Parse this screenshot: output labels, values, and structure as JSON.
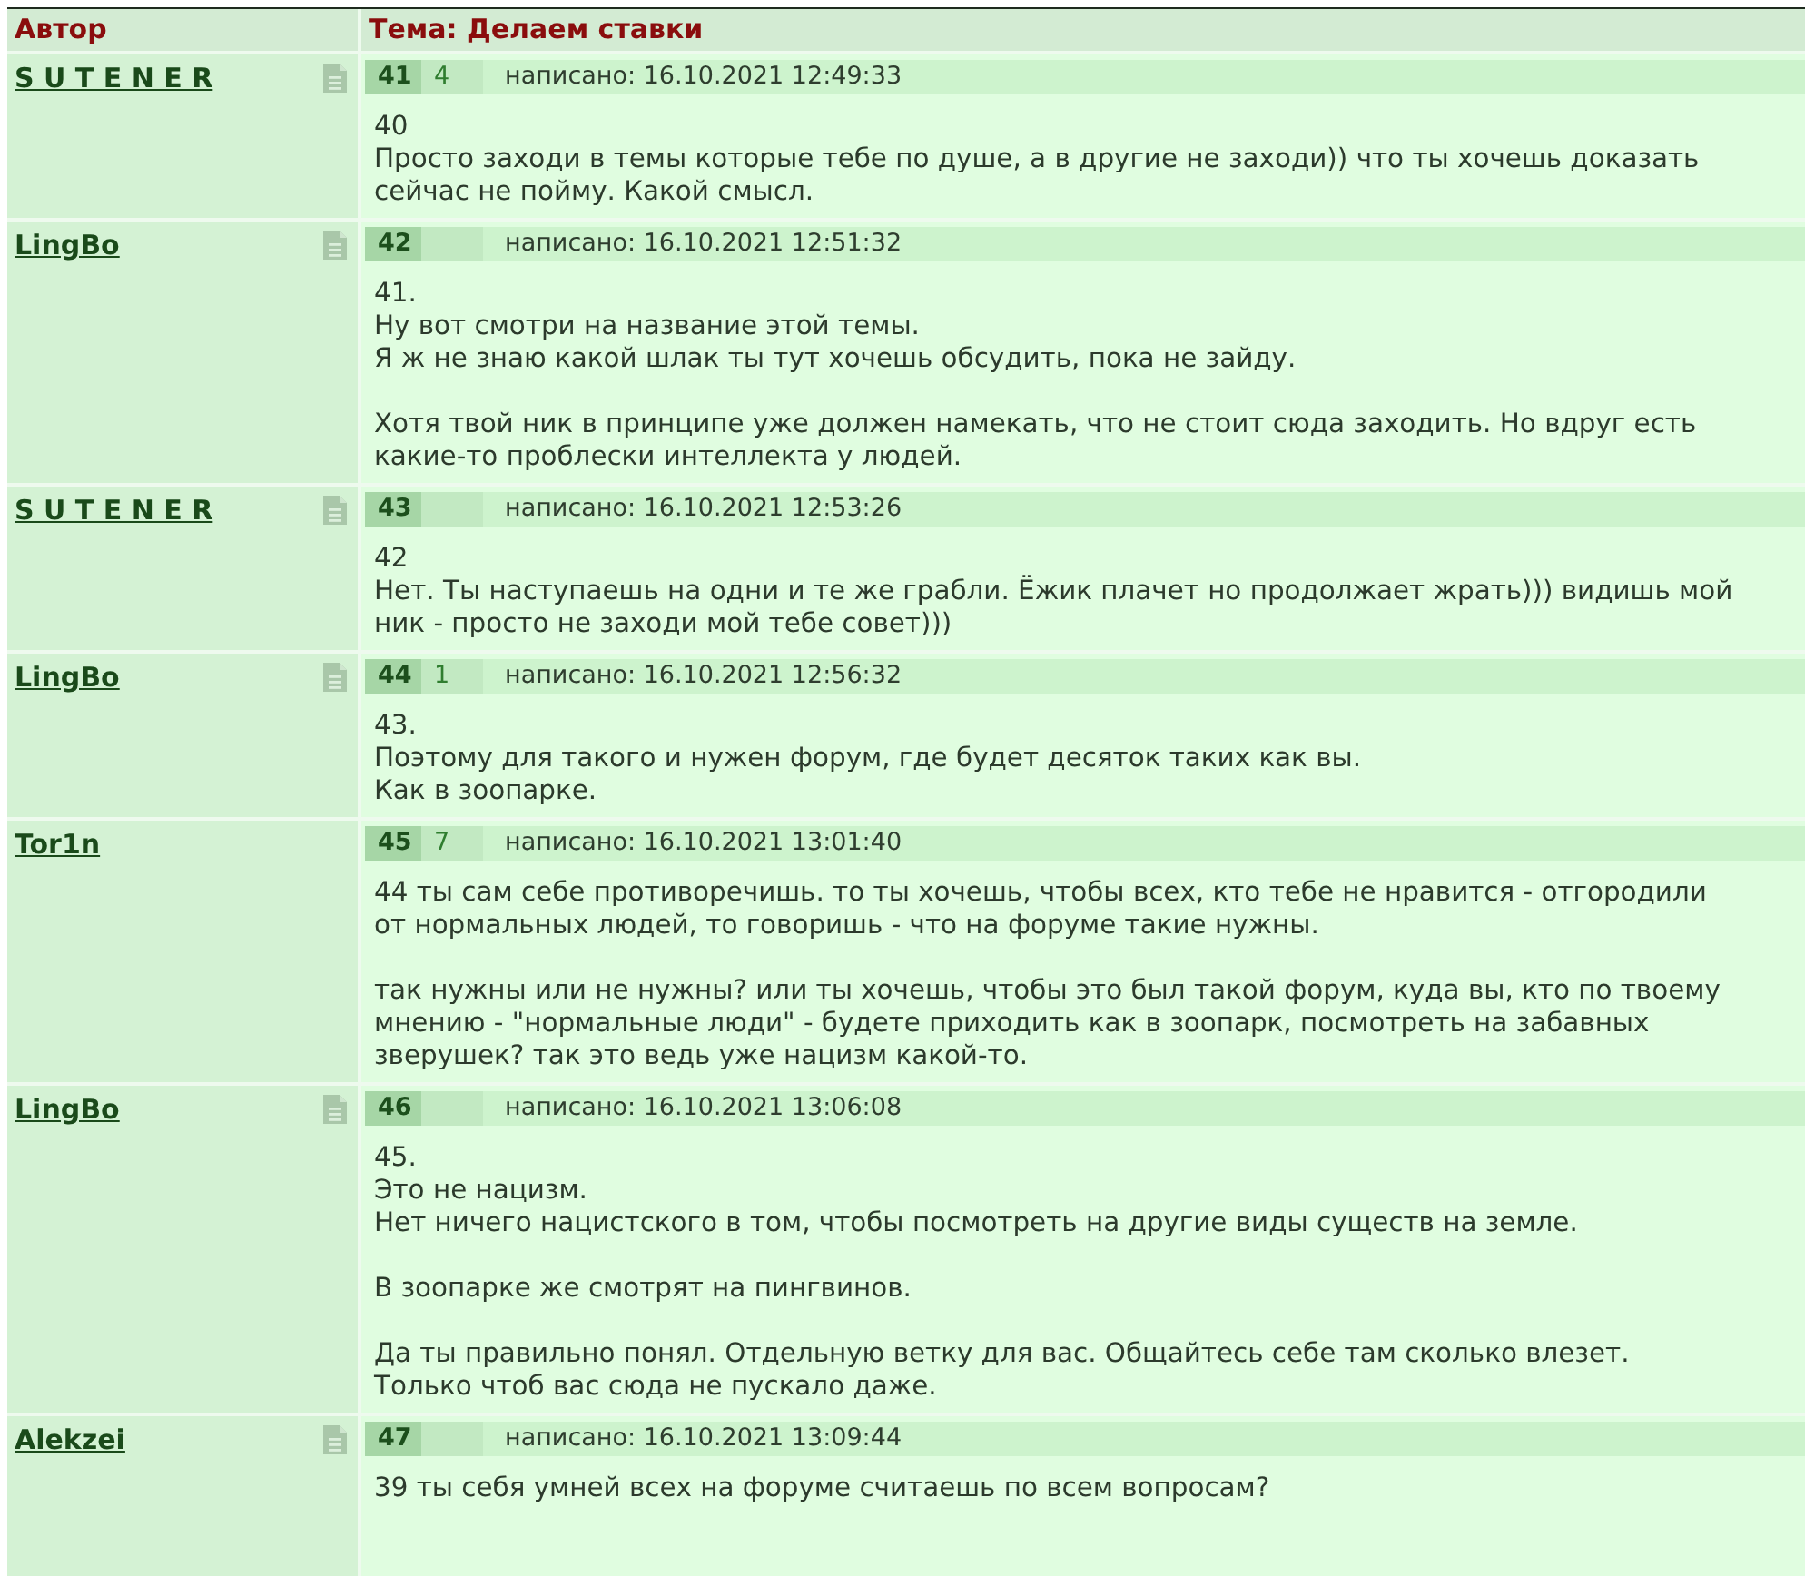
{
  "header": {
    "author_label": "Автор",
    "topic_label": "Тема: Делаем ставки"
  },
  "posts": [
    {
      "author": "S U T E N E R",
      "has_profile_icon": true,
      "number": "41",
      "rating": "4",
      "posted": "написано: 16.10.2021 12:49:33",
      "text": "40\nПросто заходи в темы которые тебе по душе, а в другие не заходи)) что ты хочешь доказать\nсейчас не пойму. Какой смысл."
    },
    {
      "author": "LingBo",
      "has_profile_icon": true,
      "number": "42",
      "posted": "написано: 16.10.2021 12:51:32",
      "text": "41.\nНу вот смотри на название этой темы.\nЯ ж не знаю какой шлак ты тут хочешь обсудить, пока не зайду.\n\nХотя твой ник в принципе уже должен намекать, что не стоит сюда заходить. Но вдруг есть\nкакие-то проблески интеллекта у людей."
    },
    {
      "author": "S U T E N E R",
      "has_profile_icon": true,
      "number": "43",
      "posted": "написано: 16.10.2021 12:53:26",
      "text": "42\nНет. Ты наступаешь на одни и те же грабли. Ёжик плачет но продолжает жрать))) видишь мой\nник - просто не заходи мой тебе совет)))"
    },
    {
      "author": "LingBo",
      "has_profile_icon": true,
      "number": "44",
      "rating": "1",
      "posted": "написано: 16.10.2021 12:56:32",
      "text": "43.\nПоэтому для такого и нужен форум, где будет десяток таких как вы.\nКак в зоопарке."
    },
    {
      "author": "Tor1n",
      "has_profile_icon": false,
      "number": "45",
      "rating": "7",
      "posted": "написано: 16.10.2021 13:01:40",
      "text": "44 ты сам себе противоречишь. то ты хочешь, чтобы всех, кто тебе не нравится - отгородили\nот нормальных людей, то говоришь - что на форуме такие нужны.\n\nтак нужны или не нужны? или ты хочешь, чтобы это был такой форум, куда вы, кто по твоему\nмнению - \"нормальные люди\" - будете приходить как в зоопарк, посмотреть на забавных\nзверушек? так это ведь уже нацизм какой-то."
    },
    {
      "author": "LingBo",
      "has_profile_icon": true,
      "number": "46",
      "posted": "написано: 16.10.2021 13:06:08",
      "text": "45.\nЭто не нацизм.\nНет ничего нацистского в том, чтобы посмотреть на другие виды существ на земле.\n\nВ зоопарке же смотрят на пингвинов.\n\nДа ты правильно понял. Отдельную ветку для вас. Общайтесь себе там сколько влезет.\nТолько чтоб вас сюда не пускало даже."
    },
    {
      "author": "Alekzei",
      "has_profile_icon": true,
      "number": "47",
      "posted": "написано: 16.10.2021 13:09:44",
      "text": "39 ты себя умней всех на форуме считаешь по всем вопросам?"
    }
  ]
}
